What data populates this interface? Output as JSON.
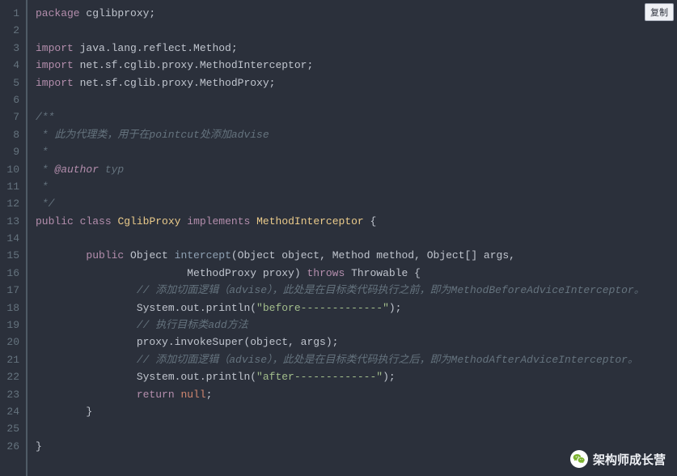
{
  "copy_label": "复制",
  "watermark": "架构师成长营",
  "lines": [
    [
      [
        "keyword",
        "package"
      ],
      [
        "pkg",
        " cglibproxy;"
      ]
    ],
    [],
    [
      [
        "keyword",
        "import"
      ],
      [
        "pkg",
        " java.lang.reflect.Method;"
      ]
    ],
    [
      [
        "keyword",
        "import"
      ],
      [
        "pkg",
        " net.sf.cglib.proxy.MethodInterceptor;"
      ]
    ],
    [
      [
        "keyword",
        "import"
      ],
      [
        "pkg",
        " net.sf.cglib.proxy.MethodProxy;"
      ]
    ],
    [],
    [
      [
        "comment",
        "/**"
      ]
    ],
    [
      [
        "comment",
        " * 此为代理类，用于在pointcut处添加advise"
      ]
    ],
    [
      [
        "comment",
        " *"
      ]
    ],
    [
      [
        "comment",
        " * "
      ],
      [
        "doctag",
        "@author"
      ],
      [
        "comment",
        " typ"
      ]
    ],
    [
      [
        "comment",
        " *"
      ]
    ],
    [
      [
        "comment",
        " */"
      ]
    ],
    [
      [
        "keyword",
        "public"
      ],
      [
        "punct",
        " "
      ],
      [
        "keyword",
        "class"
      ],
      [
        "punct",
        " "
      ],
      [
        "type",
        "CglibProxy"
      ],
      [
        "punct",
        " "
      ],
      [
        "keyword",
        "implements"
      ],
      [
        "punct",
        " "
      ],
      [
        "type",
        "MethodInterceptor"
      ],
      [
        "punct",
        " {"
      ]
    ],
    [],
    [
      [
        "punct",
        "        "
      ],
      [
        "keyword",
        "public"
      ],
      [
        "punct",
        " Object "
      ],
      [
        "func",
        "intercept"
      ],
      [
        "punct",
        "(Object object, Method method, Object[] args,"
      ]
    ],
    [
      [
        "punct",
        "                        MethodProxy proxy) "
      ],
      [
        "keyword",
        "throws"
      ],
      [
        "punct",
        " Throwable {"
      ]
    ],
    [
      [
        "punct",
        "                "
      ],
      [
        "comment",
        "// 添加切面逻辑（advise），此处是在目标类代码执行之前，即为MethodBeforeAdviceInterceptor。"
      ]
    ],
    [
      [
        "punct",
        "                System.out.println("
      ],
      [
        "string",
        "\"before-------------\""
      ],
      [
        "punct",
        ");"
      ]
    ],
    [
      [
        "punct",
        "                "
      ],
      [
        "comment",
        "// 执行目标类add方法"
      ]
    ],
    [
      [
        "punct",
        "                proxy.invokeSuper(object, args);"
      ]
    ],
    [
      [
        "punct",
        "                "
      ],
      [
        "comment",
        "// 添加切面逻辑（advise），此处是在目标类代码执行之后，即为MethodAfterAdviceInterceptor。"
      ]
    ],
    [
      [
        "punct",
        "                System.out.println("
      ],
      [
        "string",
        "\"after-------------\""
      ],
      [
        "punct",
        ");"
      ]
    ],
    [
      [
        "punct",
        "                "
      ],
      [
        "keyword",
        "return"
      ],
      [
        "punct",
        " "
      ],
      [
        "null",
        "null"
      ],
      [
        "punct",
        ";"
      ]
    ],
    [
      [
        "punct",
        "        }"
      ]
    ],
    [],
    [
      [
        "punct",
        "}"
      ]
    ]
  ]
}
